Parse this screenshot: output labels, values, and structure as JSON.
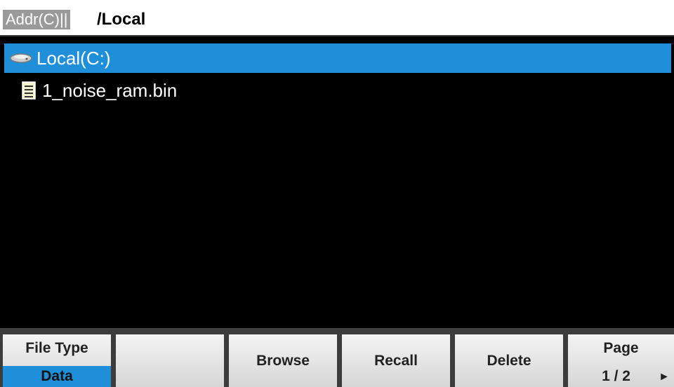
{
  "address": {
    "label": "Addr(C)||",
    "path": "/Local"
  },
  "files": [
    {
      "name": "Local(C:)",
      "icon": "drive-icon",
      "selected": true
    },
    {
      "name": "1_noise_ram.bin",
      "icon": "file-icon",
      "selected": false
    }
  ],
  "menu": {
    "file_type_label": "File Type",
    "file_type_value": "Data",
    "blank": "",
    "browse": "Browse",
    "recall": "Recall",
    "delete": "Delete",
    "page_label": "Page",
    "page_value": "1 / 2"
  },
  "colors": {
    "highlight": "#1e8fd8",
    "menu_bg": "#3c3c3c",
    "screen_bg": "#000000"
  }
}
